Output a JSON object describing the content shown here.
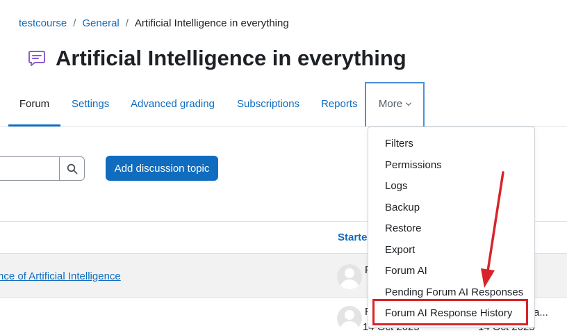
{
  "breadcrumb": {
    "items": [
      "testcourse",
      "General"
    ],
    "separator": "/",
    "current": "Artificial Intelligence in everything"
  },
  "page": {
    "title": "Artificial Intelligence in everything",
    "icon": "forum-speech-bubble-icon",
    "icon_color": "#8a5dcf"
  },
  "tabs": {
    "forum": "Forum",
    "settings": "Settings",
    "advanced_grading": "Advanced grading",
    "subscriptions": "Subscriptions",
    "reports": "Reports",
    "more": "More"
  },
  "search": {
    "value": "",
    "icon": "search-icon"
  },
  "actions": {
    "add_discussion": "Add discussion topic"
  },
  "table": {
    "started_by_header": "Starte",
    "row1_link": "nce of Artificial Intelligence",
    "row1_author_fragment": "F",
    "row2_author_fragment": "F",
    "row2_date_fragment": "14 Oct 2025",
    "row2_right_date_fragment": "14 Oct 2025",
    "row2_right_fragment": "a..."
  },
  "more_menu": {
    "items": [
      "Filters",
      "Permissions",
      "Logs",
      "Backup",
      "Restore",
      "Export",
      "Forum AI",
      "Pending Forum AI Responses",
      "Forum AI Response History"
    ],
    "highlighted": "Forum AI Response History"
  },
  "colors": {
    "link": "#0f6cbf",
    "primary_button": "#0f6cbf",
    "annotation_red": "#d9232a",
    "focus_outline": "#4a90d9"
  }
}
